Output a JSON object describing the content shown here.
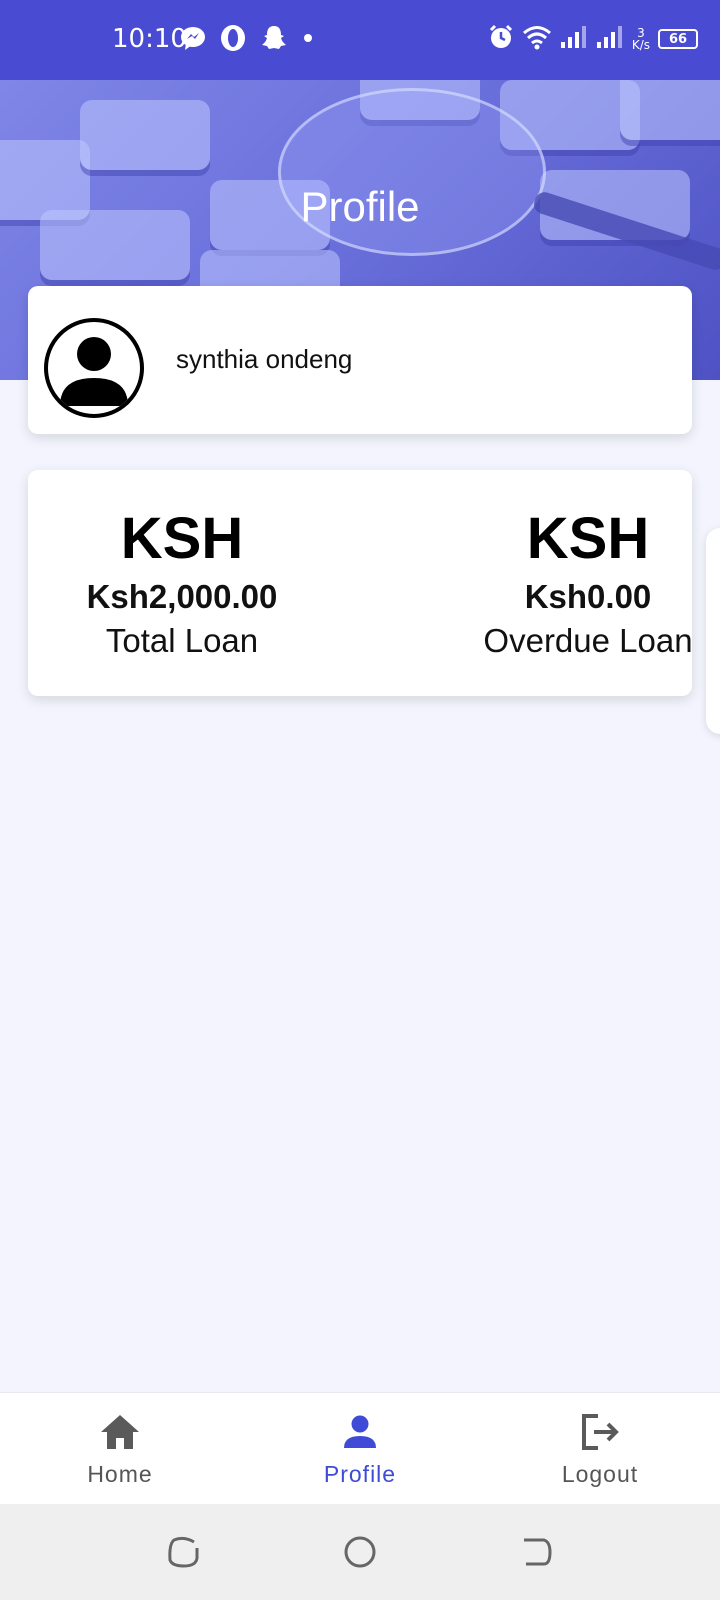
{
  "status_bar": {
    "time": "10:10",
    "network_speed_value": "3",
    "network_speed_unit": "K/s",
    "battery": "66"
  },
  "header": {
    "title": "Profile"
  },
  "profile": {
    "name": "synthia ondeng"
  },
  "loans": [
    {
      "currency": "KSH",
      "amount": "Ksh2,000.00",
      "label": "Total Loan"
    },
    {
      "currency": "KSH",
      "amount": "Ksh0.00",
      "label": "Overdue Loan"
    }
  ],
  "nav": {
    "home_label": "Home",
    "profile_label": "Profile",
    "logout_label": "Logout",
    "active": "Profile",
    "active_color": "#3f4bd6"
  },
  "colors": {
    "status_bar": "#4a4bd3",
    "background": "#f3f4fd"
  },
  "icons": {
    "status_left": [
      "messenger-icon",
      "opera-icon",
      "snapchat-icon",
      "dot-icon"
    ],
    "status_right": [
      "alarm-icon",
      "wifi-icon",
      "signal-icon",
      "signal-icon",
      "battery-icon"
    ],
    "nav": [
      "home-icon",
      "person-icon",
      "logout-icon"
    ]
  }
}
